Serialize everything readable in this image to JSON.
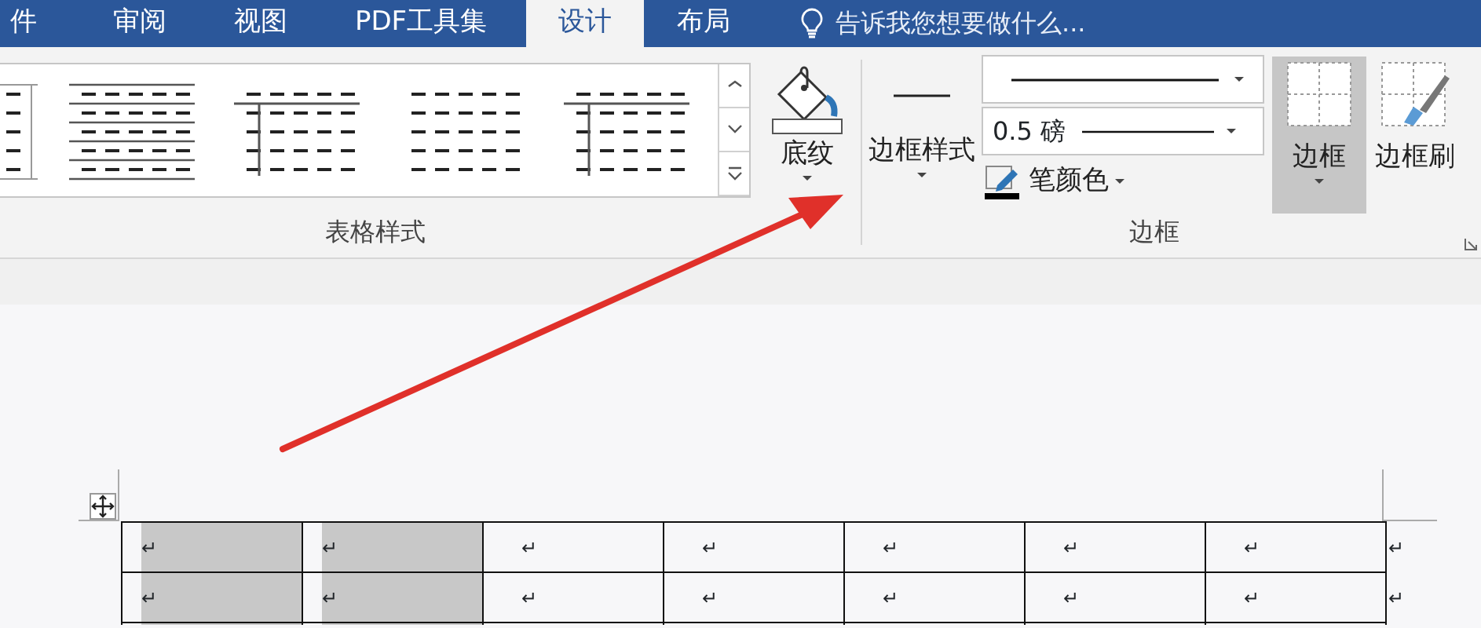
{
  "tabs": [
    {
      "label": "件",
      "selected": false
    },
    {
      "label": "审阅",
      "selected": false
    },
    {
      "label": "视图",
      "selected": false
    },
    {
      "label": "PDF工具集",
      "selected": false
    },
    {
      "label": "设计",
      "selected": true
    },
    {
      "label": "布局",
      "selected": false
    }
  ],
  "tell_me": {
    "placeholder": "告诉我您想要做什么..."
  },
  "table_styles": {
    "label": "表格样式",
    "styles": [
      {
        "kind": "grid"
      },
      {
        "kind": "banded"
      },
      {
        "kind": "header-column"
      },
      {
        "kind": "plain"
      },
      {
        "kind": "header-column"
      }
    ]
  },
  "shading": {
    "label": "底纹"
  },
  "borders": {
    "label": "边框",
    "border_styles": "边框样式",
    "line_weight": "0.5 磅",
    "pen_color": "笔颜色",
    "borders_button": {
      "label": "边框",
      "selected": true
    },
    "border_painter": "边框刷"
  },
  "table": {
    "rows": [
      {
        "cells": [
          {
            "mark": "↵",
            "selected": true
          },
          {
            "mark": "↵",
            "selected": true
          },
          {
            "mark": "↵",
            "selected": false
          },
          {
            "mark": "↵",
            "selected": false
          },
          {
            "mark": "↵",
            "selected": false
          },
          {
            "mark": "↵",
            "selected": false
          },
          {
            "mark": "↵",
            "selected": false
          }
        ],
        "end_mark": "↵"
      },
      {
        "cells": [
          {
            "mark": "↵",
            "selected": true
          },
          {
            "mark": "↵",
            "selected": true
          },
          {
            "mark": "↵",
            "selected": false
          },
          {
            "mark": "↵",
            "selected": false
          },
          {
            "mark": "↵",
            "selected": false
          },
          {
            "mark": "↵",
            "selected": false
          },
          {
            "mark": "↵",
            "selected": false
          }
        ],
        "end_mark": "↵"
      }
    ]
  }
}
